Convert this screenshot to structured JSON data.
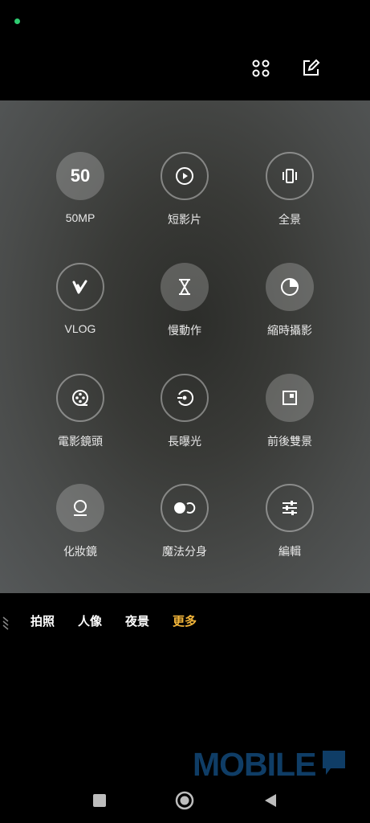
{
  "top_bar": {
    "icons": [
      "status-dot",
      "grid-apps-icon",
      "edit-icon"
    ]
  },
  "modes_grid": [
    {
      "label": "50MP",
      "icon": "50",
      "filled": true
    },
    {
      "label": "短影片",
      "icon": "play-icon",
      "filled": false
    },
    {
      "label": "全景",
      "icon": "panorama-icon",
      "filled": false
    },
    {
      "label": "VLOG",
      "icon": "vlog-icon",
      "filled": false
    },
    {
      "label": "慢動作",
      "icon": "hourglass-icon",
      "filled": true
    },
    {
      "label": "縮時攝影",
      "icon": "timelapse-icon",
      "filled": true
    },
    {
      "label": "電影鏡頭",
      "icon": "film-reel-icon",
      "filled": false
    },
    {
      "label": "長曝光",
      "icon": "long-exposure-icon",
      "filled": false
    },
    {
      "label": "前後雙景",
      "icon": "dual-view-icon",
      "filled": true
    },
    {
      "label": "化妝鏡",
      "icon": "mirror-icon",
      "filled": true
    },
    {
      "label": "魔法分身",
      "icon": "clone-icon",
      "filled": false
    },
    {
      "label": "編輯",
      "icon": "sliders-icon",
      "filled": false
    }
  ],
  "mode_bar": {
    "items": [
      {
        "label": "拍照"
      },
      {
        "label": "人像"
      },
      {
        "label": "夜景"
      },
      {
        "label": "更多",
        "active": true
      }
    ],
    "active_color": "#f2b53a"
  },
  "watermark": {
    "text": "MOBILE"
  },
  "nav_bar": {
    "icons": [
      "recent-apps-icon",
      "home-icon",
      "back-icon"
    ]
  }
}
